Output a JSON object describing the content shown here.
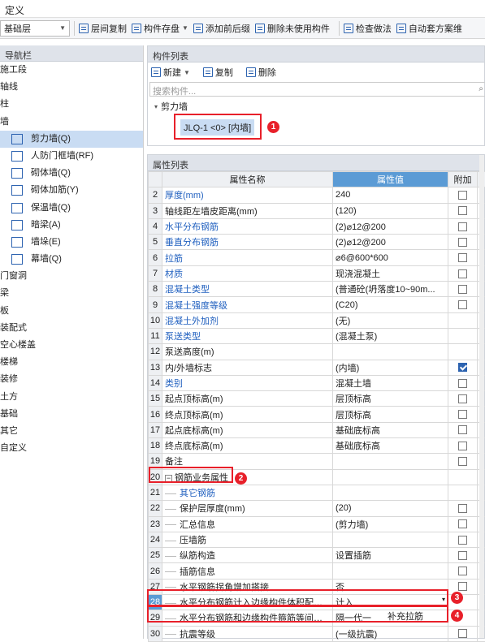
{
  "menu": {
    "title": "定义"
  },
  "toolbar": {
    "layer": "基础层",
    "buttons": [
      "层间复制",
      "构件存盘",
      "添加前后缀",
      "删除未使用构件",
      "检查做法",
      "自动套方案维"
    ]
  },
  "nav": {
    "title": "导航栏",
    "items": [
      "施工段",
      "轴线",
      "柱",
      "墙"
    ],
    "sub": [
      "剪力墙(Q)",
      "人防门框墙(RF)",
      "砌体墙(Q)",
      "砌体加筋(Y)",
      "保温墙(Q)",
      "暗梁(A)",
      "墙垛(E)",
      "幕墙(Q)"
    ],
    "items2": [
      "门窗洞",
      "梁",
      "板",
      "装配式",
      "空心楼盖",
      "楼梯",
      "装修",
      "土方",
      "基础",
      "其它",
      "自定义"
    ]
  },
  "complist": {
    "title": "构件列表",
    "new": "新建",
    "copy": "复制",
    "delete": "删除",
    "search_placeholder": "搜索构件...",
    "root": "剪力墙",
    "item": "JLQ-1 <0> [内墙]"
  },
  "props": {
    "title": "属性列表",
    "h_name": "属性名称",
    "h_value": "属性值",
    "h_extra": "附加"
  },
  "rows": [
    {
      "n": "2",
      "name": "厚度(mm)",
      "val": "240",
      "blue": true,
      "cb": false
    },
    {
      "n": "3",
      "name": "轴线距左墙皮距离(mm)",
      "val": "(120)",
      "blue": false,
      "cb": false
    },
    {
      "n": "4",
      "name": "水平分布钢筋",
      "val": "(2)⌀12@200",
      "blue": true,
      "cb": false
    },
    {
      "n": "5",
      "name": "垂直分布钢筋",
      "val": "(2)⌀12@200",
      "blue": true,
      "cb": false
    },
    {
      "n": "6",
      "name": "拉筋",
      "val": "⌀6@600*600",
      "blue": true,
      "cb": false
    },
    {
      "n": "7",
      "name": "材质",
      "val": "现浇混凝土",
      "blue": true,
      "cb": false
    },
    {
      "n": "8",
      "name": "混凝土类型",
      "val": "(普通砼(坍落度10~90m...",
      "blue": true,
      "cb": false
    },
    {
      "n": "9",
      "name": "混凝土强度等级",
      "val": "(C20)",
      "blue": true,
      "cb": false
    },
    {
      "n": "10",
      "name": "混凝土外加剂",
      "val": "(无)",
      "blue": true,
      "cb": null
    },
    {
      "n": "11",
      "name": "泵送类型",
      "val": "(混凝土泵)",
      "blue": true,
      "cb": null
    },
    {
      "n": "12",
      "name": "泵送高度(m)",
      "val": "",
      "blue": false,
      "cb": null
    },
    {
      "n": "13",
      "name": "内/外墙标志",
      "val": "(内墙)",
      "blue": false,
      "cb": true
    },
    {
      "n": "14",
      "name": "类别",
      "val": "混凝土墙",
      "blue": true,
      "cb": false
    },
    {
      "n": "15",
      "name": "起点顶标高(m)",
      "val": "层顶标高",
      "blue": false,
      "cb": false
    },
    {
      "n": "16",
      "name": "终点顶标高(m)",
      "val": "层顶标高",
      "blue": false,
      "cb": false
    },
    {
      "n": "17",
      "name": "起点底标高(m)",
      "val": "基础底标高",
      "blue": false,
      "cb": false
    },
    {
      "n": "18",
      "name": "终点底标高(m)",
      "val": "基础底标高",
      "blue": false,
      "cb": false
    },
    {
      "n": "19",
      "name": "备注",
      "val": "",
      "blue": false,
      "cb": false
    },
    {
      "n": "20",
      "name": "钢筋业务属性",
      "val": "",
      "blue": false,
      "cb": null,
      "group": true
    },
    {
      "n": "21",
      "name": "其它钢筋",
      "val": "",
      "blue": true,
      "cb": null,
      "indent": true
    },
    {
      "n": "22",
      "name": "保护层厚度(mm)",
      "val": "(20)",
      "blue": false,
      "cb": false,
      "indent": true
    },
    {
      "n": "23",
      "name": "汇总信息",
      "val": "(剪力墙)",
      "blue": false,
      "cb": false,
      "indent": true
    },
    {
      "n": "24",
      "name": "压墙筋",
      "val": "",
      "blue": false,
      "cb": false,
      "indent": true
    },
    {
      "n": "25",
      "name": "纵筋构造",
      "val": "设置插筋",
      "blue": false,
      "cb": false,
      "indent": true
    },
    {
      "n": "26",
      "name": "插筋信息",
      "val": "",
      "blue": false,
      "cb": false,
      "indent": true
    },
    {
      "n": "27",
      "name": "水平钢筋拐角增加搭接",
      "val": "否",
      "blue": false,
      "cb": false,
      "indent": true
    },
    {
      "n": "28",
      "name": "水平分布钢筋计入边缘构件体积配箍率",
      "val": "计入",
      "blue": false,
      "cb": null,
      "indent": true,
      "dropdown": true
    },
    {
      "n": "29",
      "name": "水平分布钢筋和边缘构件箍筋等间距时",
      "val": "隔一代一",
      "blue": false,
      "cb": null,
      "indent": true
    },
    {
      "n": "30",
      "name": "抗震等级",
      "val": "(一级抗震)",
      "blue": false,
      "cb": false,
      "indent": true
    }
  ],
  "annot": {
    "note": "补充拉筋",
    "b1": "1",
    "b2": "2",
    "b3": "3",
    "b4": "4"
  }
}
